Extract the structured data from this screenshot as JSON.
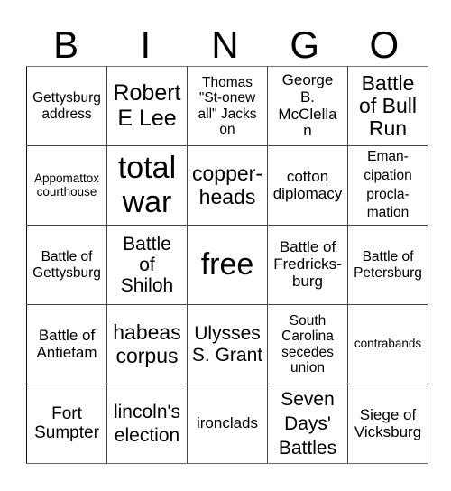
{
  "header": {
    "letters": [
      "B",
      "I",
      "N",
      "G",
      "O"
    ]
  },
  "card": {
    "rows": [
      [
        "Gettysburg address",
        "Robert E Lee",
        "Thomas \"St-onewall\" Jackson",
        "George B. McClellan",
        "Battle of Bull Run"
      ],
      [
        "Appomattox courthouse",
        "total war",
        "copper-heads",
        "cotton diplomacy",
        "Eman-cipation procla-mation"
      ],
      [
        "Battle of Gettysburg",
        "Battle of Shiloh",
        "free",
        "Battle of Fredricks-burg",
        "Battle of Petersburg"
      ],
      [
        "Battle of Antietam",
        "habeas corpus",
        "Ulysses S. Grant",
        "South Carolina secedes union",
        "contrabands"
      ],
      [
        "Fort Sumpter",
        "lincoln's election",
        "ironclads",
        "Seven Days' Battles",
        "Siege of Vicksburg"
      ]
    ]
  }
}
